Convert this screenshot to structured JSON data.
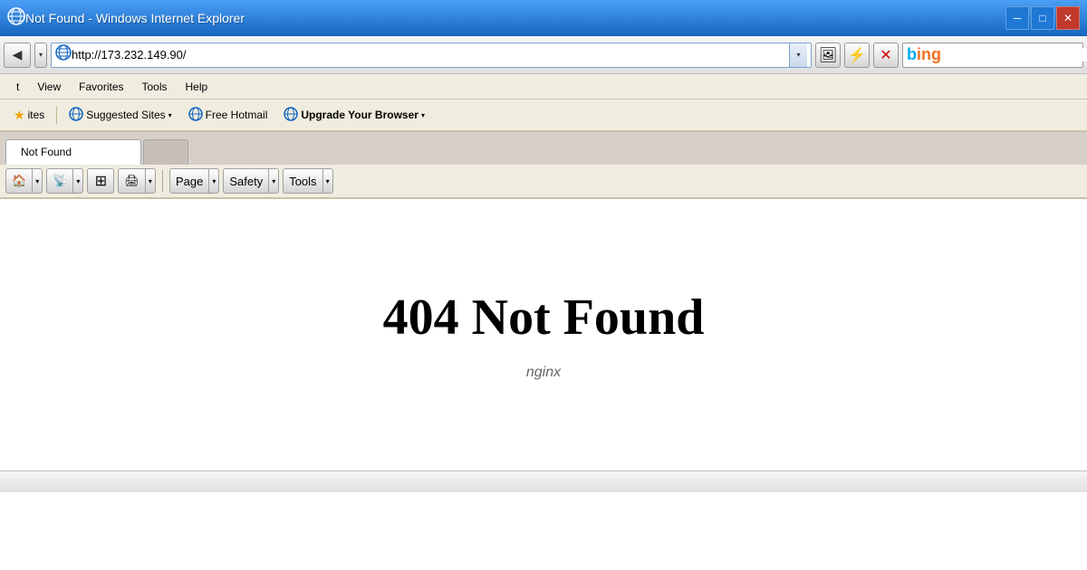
{
  "titleBar": {
    "text": "Not Found - Windows Internet Explorer",
    "minimizeLabel": "─",
    "restoreLabel": "□",
    "closeLabel": "✕"
  },
  "navBar": {
    "backArrow": "◀",
    "dropdownArrow": "▾",
    "addressUrl": "http://173.232.149.90/",
    "addressPlaceholder": "http://173.232.149.90/",
    "refreshIcon": "↺",
    "stopIcon": "✕",
    "bingLabel": "Bing",
    "imageIcon": "🖼",
    "favoriteIcon": "⚡"
  },
  "menuBar": {
    "items": [
      "t",
      "View",
      "Favorites",
      "Tools",
      "Help"
    ]
  },
  "favoritesBar": {
    "sitesLabel": "ites",
    "suggestedSitesLabel": "Suggested Sites",
    "freeHotmailLabel": "Free Hotmail",
    "upgradeLabel": "Upgrade Your Browser"
  },
  "tabBar": {
    "activeTab": "Not Found",
    "newTabLabel": "+"
  },
  "toolbar": {
    "homeIcon": "🏠",
    "rssIcon": "📡",
    "readingIcon": "⊞",
    "printIcon": "🖨",
    "pageLabel": "Page",
    "safetyLabel": "Safety",
    "toolsLabel": "Tools",
    "dropdownArrow": "▾"
  },
  "content": {
    "heading": "404 Not Found",
    "subtext": "nginx"
  },
  "statusBar": {
    "text": ""
  }
}
